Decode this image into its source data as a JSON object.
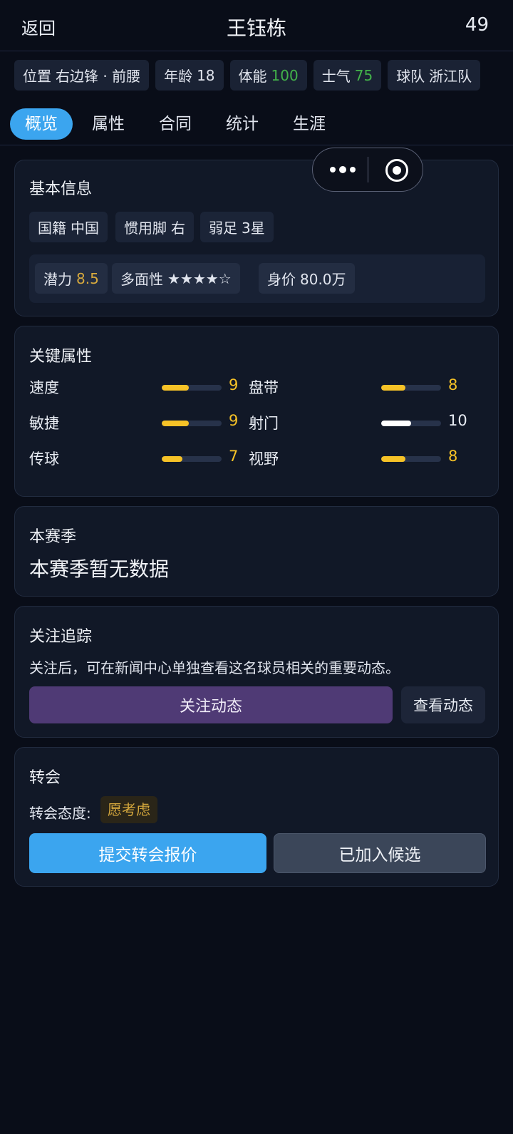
{
  "header": {
    "back": "返回",
    "title": "王钰栋",
    "number": "49"
  },
  "chips": [
    {
      "label": "位置",
      "value": "右边锋 · 前腰",
      "color": "#e1e5ee"
    },
    {
      "label": "年龄",
      "value": "18",
      "color": "#e1e5ee"
    },
    {
      "label": "体能",
      "value": "100",
      "color": "#43b34a"
    },
    {
      "label": "士气",
      "value": "75",
      "color": "#43b34a"
    },
    {
      "label": "球队",
      "value": "浙江队",
      "color": "#e1e5ee"
    }
  ],
  "tabs": [
    "概览",
    "属性",
    "合同",
    "统计",
    "生涯"
  ],
  "basic": {
    "title": "基本信息",
    "items": [
      {
        "label": "国籍",
        "value": "中国"
      },
      {
        "label": "惯用脚",
        "value": "右"
      },
      {
        "label": "弱足",
        "value": "3星"
      }
    ],
    "panel": [
      {
        "label": "潜力",
        "value": "8.5"
      },
      {
        "label": "多面性",
        "value": "★★★★☆"
      },
      {
        "label": "身价",
        "value": "80.0万"
      }
    ]
  },
  "key_attrs": {
    "title": "关键属性",
    "max": 20,
    "items": [
      {
        "name": "速度",
        "value": 9,
        "color": "#f6c227"
      },
      {
        "name": "盘带",
        "value": 8,
        "color": "#f6c227"
      },
      {
        "name": "敏捷",
        "value": 9,
        "color": "#f6c227"
      },
      {
        "name": "射门",
        "value": 10,
        "color": "#ffffff"
      },
      {
        "name": "传球",
        "value": 7,
        "color": "#f6c227"
      },
      {
        "name": "视野",
        "value": 8,
        "color": "#f6c227"
      }
    ]
  },
  "season": {
    "title": "本赛季",
    "empty": "本赛季暂无数据"
  },
  "follow": {
    "title": "关注追踪",
    "desc": "关注后，可在新闻中心单独查看这名球员相关的重要动态。",
    "follow_btn": "关注动态",
    "view_btn": "查看动态"
  },
  "transfer": {
    "title": "转会",
    "attitude_label": "转会态度:",
    "attitude_value": "愿考虑",
    "offer_btn": "提交转会报价",
    "shortlist_btn": "已加入候选"
  }
}
